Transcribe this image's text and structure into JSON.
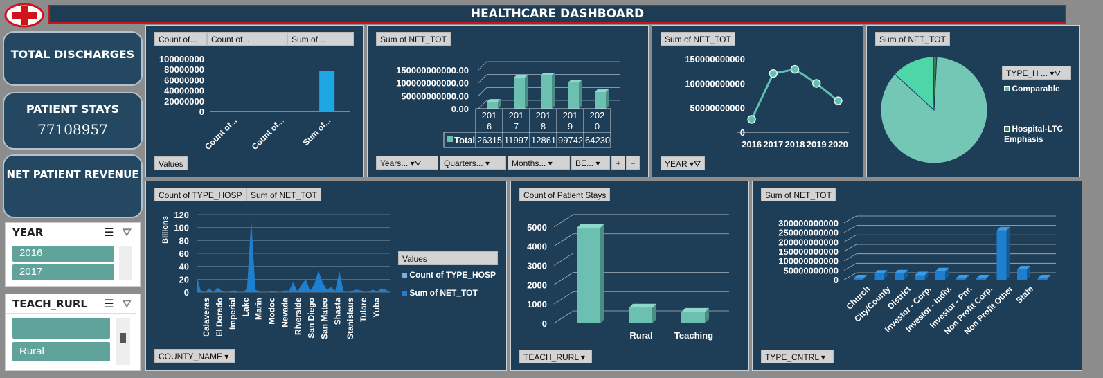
{
  "header": {
    "title": "HEALTHCARE DASHBOARD"
  },
  "kpis": {
    "total_discharges": {
      "label": "TOTAL DISCHARGES",
      "value": ""
    },
    "patient_stays": {
      "label": "PATIENT STAYS",
      "value": "77108957"
    },
    "net_patient_revenue": {
      "label": "NET PATIENT REVENUE",
      "value": ""
    }
  },
  "slicers": {
    "year": {
      "title": "YEAR",
      "items": [
        "2016",
        "2017"
      ]
    },
    "teach_rurl": {
      "title": "TEACH_RURL",
      "items": [
        "",
        "Rural"
      ]
    }
  },
  "panels": {
    "p1": {
      "buttons": [
        "Count of...",
        "Count of...",
        "Sum of..."
      ],
      "footer": "Values"
    },
    "p2": {
      "buttons": [
        "Sum of NET_TOT"
      ],
      "footer": [
        "Years...",
        "Quarters...",
        "Months...",
        "BE..."
      ],
      "table_label": "Total",
      "table_values": [
        "26315",
        "11997",
        "12861",
        "99742",
        "64230"
      ],
      "years": [
        "201\n6",
        "201\n7",
        "201\n8",
        "201\n9",
        "202\n0"
      ]
    },
    "p3": {
      "buttons": [
        "Sum of NET_TOT"
      ],
      "footer": "YEAR"
    },
    "p4": {
      "buttons": [
        "Sum of NET_TOT"
      ],
      "legend_title": "TYPE_H ...",
      "legend": [
        "Comparable",
        "Hospital-LTC Emphasis"
      ]
    },
    "p5": {
      "buttons": [
        "Count of TYPE_HOSP",
        "Sum of NET_TOT"
      ],
      "footer": "COUNTY_NAME",
      "ylabel": "Billions",
      "legend_title": "Values",
      "legend": [
        "Count of TYPE_HOSP",
        "Sum of NET_TOT"
      ]
    },
    "p6": {
      "buttons": [
        "Count of Patient Stays"
      ],
      "footer": "TEACH_RURL"
    },
    "p7": {
      "buttons": [
        "Sum of NET_TOT"
      ],
      "footer": "TYPE_CNTRL"
    }
  },
  "colors": {
    "accent": "#5fbfb0",
    "blue": "#1e7fd0",
    "panel": "#1e3d56",
    "title_border": "#c8141c"
  },
  "chart_data": [
    {
      "id": "c1",
      "type": "bar",
      "categories": [
        "Count of...",
        "Count of...",
        "Sum of..."
      ],
      "values": [
        0,
        0,
        77000000
      ],
      "ylim": [
        0,
        100000000
      ],
      "yticks": [
        "100000000",
        "80000000",
        "60000000",
        "40000000",
        "20000000",
        "0"
      ]
    },
    {
      "id": "c2",
      "type": "bar",
      "categories": [
        "2016",
        "2017",
        "2018",
        "2019",
        "2020"
      ],
      "values": [
        26315000000,
        119970000000,
        128610000000,
        99742000000,
        64230000000
      ],
      "ylim": [
        0,
        150000000000
      ],
      "yticks": [
        "150000000000.00",
        "100000000000.00",
        "50000000000.00",
        "0.00"
      ]
    },
    {
      "id": "c3",
      "type": "line",
      "x": [
        "2016",
        "2017",
        "2018",
        "2019",
        "2020"
      ],
      "values": [
        26315000000,
        119970000000,
        128610000000,
        99742000000,
        64230000000
      ],
      "ylim": [
        0,
        150000000000
      ],
      "yticks": [
        "150000000000",
        "100000000000",
        "50000000000",
        "0"
      ]
    },
    {
      "id": "c4",
      "type": "pie",
      "categories": [
        "Comparable",
        "Hospital-LTC Emphasis"
      ],
      "values": [
        86,
        13,
        1
      ]
    },
    {
      "id": "c5",
      "type": "area",
      "ylabel": "Billions",
      "yticks": [
        "120",
        "100",
        "80",
        "60",
        "40",
        "20",
        "0"
      ],
      "ylim": [
        0,
        120
      ],
      "xlabels": [
        "Calaveras",
        "El Dorado",
        "Imperial",
        "Lake",
        "Marin",
        "Modoc",
        "Nevada",
        "Riverside",
        "San Diego",
        "San Mateo",
        "Shasta",
        "Stanislaus",
        "Tulare",
        "Yuba"
      ],
      "values": [
        25,
        2,
        0,
        6,
        0,
        7,
        2,
        0,
        1,
        3,
        0,
        0,
        5,
        113,
        4,
        1,
        0,
        0,
        2,
        1,
        0,
        3,
        2,
        16,
        1,
        12,
        20,
        2,
        12,
        33,
        15,
        4,
        8,
        2,
        32,
        1,
        0,
        2,
        4,
        3,
        0,
        1,
        4,
        1,
        6,
        4,
        0
      ]
    },
    {
      "id": "c6",
      "type": "bar",
      "categories": [
        "",
        "Rural",
        "Teaching"
      ],
      "values": [
        4950,
        800,
        580
      ],
      "ylim": [
        0,
        5500
      ],
      "yticks": [
        "5000",
        "4000",
        "3000",
        "2000",
        "1000",
        "0"
      ]
    },
    {
      "id": "c7",
      "type": "bar",
      "categories": [
        "Church",
        "City/County",
        "District",
        "Investor - Corp.",
        "Investor - Indiv.",
        "Investor - Pnr.",
        "Non Profit Corp.",
        "Non Profit Other",
        "State"
      ],
      "values": [
        5000000000,
        32000000000,
        34000000000,
        24000000000,
        45000000000,
        3000000000,
        3000000000,
        260000000000,
        55000000000,
        3000000000
      ],
      "ylim": [
        0,
        300000000000
      ],
      "yticks": [
        "300000000000",
        "250000000000",
        "200000000000",
        "150000000000",
        "100000000000",
        "50000000000",
        "0"
      ]
    }
  ]
}
